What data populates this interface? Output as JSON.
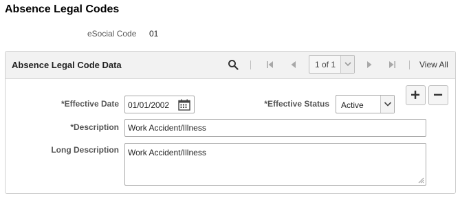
{
  "page": {
    "title": "Absence Legal Codes"
  },
  "esocial": {
    "label": "eSocial Code",
    "value": "01"
  },
  "grid": {
    "title": "Absence Legal Code Data",
    "pager_text": "1 of 1",
    "view_all_label": "View All",
    "icons": [
      "search-icon",
      "first-page-icon",
      "previous-page-icon",
      "next-page-icon",
      "last-page-icon"
    ]
  },
  "form": {
    "effective_date_label": "*Effective Date",
    "effective_date_value": "01/01/2002",
    "effective_status_label": "*Effective Status",
    "effective_status_value": "Active",
    "description_label": "*Description",
    "description_value": "Work Accident/Illness",
    "long_description_label": "Long Description",
    "long_description_value": "Work Accident/Illness"
  },
  "colors": {
    "header_bg": "#f2f2f2",
    "border": "#cfcfcf",
    "label": "#555555"
  }
}
